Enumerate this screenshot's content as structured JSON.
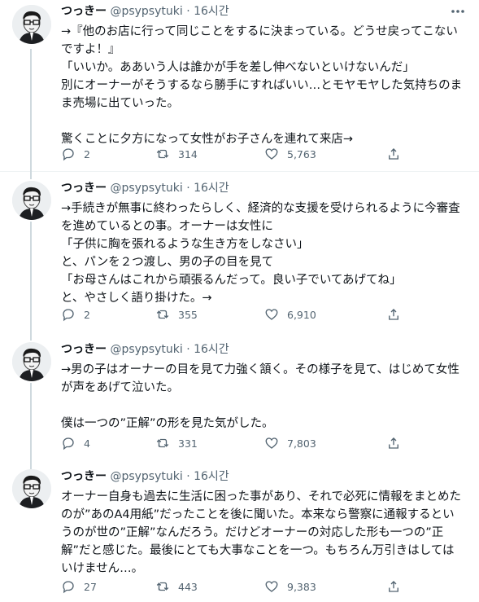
{
  "tweets": [
    {
      "name": "つっきー",
      "handle": "@psypsytuki",
      "dot": "·",
      "time": "16시간",
      "text": "→『他のお店に行って同じことをするに決まっている。どうせ戻ってこないですよ！』\n「いいか。ああいう人は誰かが手を差し伸べないといけないんだ」\n別にオーナーがそうするなら勝手にすればいい…とモヤモヤした気持ちのまま売場に出ていった。\n\n驚くことに夕方になって女性がお子さんを連れて来店→",
      "replies": "2",
      "retweets": "314",
      "likes": "5,763"
    },
    {
      "name": "つっきー",
      "handle": "@psypsytuki",
      "dot": "·",
      "time": "16시간",
      "text": "→手続きが無事に終わったらしく、経済的な支援を受けられるように今審査を進めているとの事。オーナーは女性に\n「子供に胸を張れるような生き方をしなさい」\nと、パンを２つ渡し、男の子の目を見て\n「お母さんはこれから頑張るんだって。良い子でいてあげてね」\nと、やさしく語り掛けた。→",
      "replies": "2",
      "retweets": "355",
      "likes": "6,910"
    },
    {
      "name": "つっきー",
      "handle": "@psypsytuki",
      "dot": "·",
      "time": "16시간",
      "text": "→男の子はオーナーの目を見て力強く頷く。その様子を見て、はじめて女性が声をあげて泣いた。\n\n僕は一つの”正解”の形を見た気がした。",
      "replies": "4",
      "retweets": "331",
      "likes": "7,803"
    },
    {
      "name": "つっきー",
      "handle": "@psypsytuki",
      "dot": "·",
      "time": "16시간",
      "text": "オーナー自身も過去に生活に困った事があり、それで必死に情報をまとめたのが”あのA4用紙”だったことを後に聞いた。本来なら警察に通報するというのが世の”正解”なんだろう。だけどオーナーの対応した形も一つの”正解”だと感じた。最後にとても大事なことを一つ。もちろん万引きはしてはいけません…。",
      "replies": "27",
      "retweets": "443",
      "likes": "9,383"
    }
  ],
  "icons": {
    "more": "more-icon",
    "reply": "reply-icon",
    "retweet": "retweet-icon",
    "like": "like-icon",
    "share": "share-icon"
  },
  "colors": {
    "text": "#0f1419",
    "secondary": "#536471",
    "separator": "#eff3f4",
    "thread_line": "#cfd9de"
  }
}
